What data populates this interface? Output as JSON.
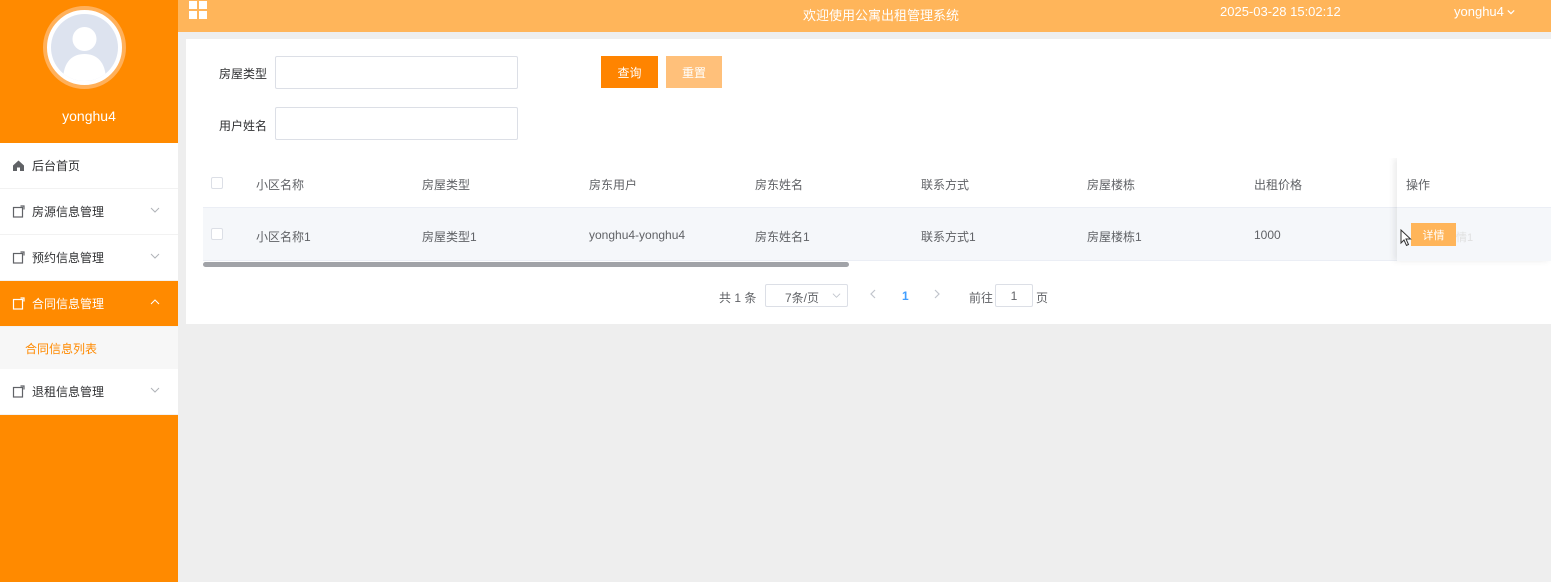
{
  "header": {
    "title": "欢迎使用公寓出租管理系统",
    "datetime": "2025-03-28 15:02:12",
    "username": "yonghu4"
  },
  "sidebar": {
    "profile_name": "yonghu4",
    "items": [
      {
        "label": "后台首页",
        "icon": "home-icon"
      },
      {
        "label": "房源信息管理",
        "icon": "document-icon"
      },
      {
        "label": "预约信息管理",
        "icon": "document-icon"
      },
      {
        "label": "合同信息管理",
        "icon": "document-icon",
        "active": true
      },
      {
        "label": "退租信息管理",
        "icon": "document-icon"
      }
    ],
    "submenu_label": "合同信息列表"
  },
  "search": {
    "house_type_label": "房屋类型",
    "house_type_value": "",
    "user_name_label": "用户姓名",
    "user_name_value": "",
    "query_label": "查询",
    "reset_label": "重置"
  },
  "table": {
    "headers": [
      "小区名称",
      "房屋类型",
      "房东用户",
      "房东姓名",
      "联系方式",
      "房屋楼栋",
      "出租价格",
      "操作"
    ],
    "rows": [
      {
        "cells": [
          "小区名称1",
          "房屋类型1",
          "yonghu4-yonghu4",
          "房东姓名1",
          "联系方式1",
          "房屋楼栋1",
          "1000"
        ],
        "detail_label": "详情",
        "ghost": "情1"
      }
    ]
  },
  "pagination": {
    "total": "共 1 条",
    "page_size": "7条/页",
    "current_page": "1",
    "goto_label": "前往",
    "goto_value": "1",
    "page_suffix": "页"
  },
  "colors": {
    "brand": "#ff8a00",
    "header_bg": "#ffb55a",
    "reset_btn": "#ffc07a",
    "link": "#409eff"
  }
}
